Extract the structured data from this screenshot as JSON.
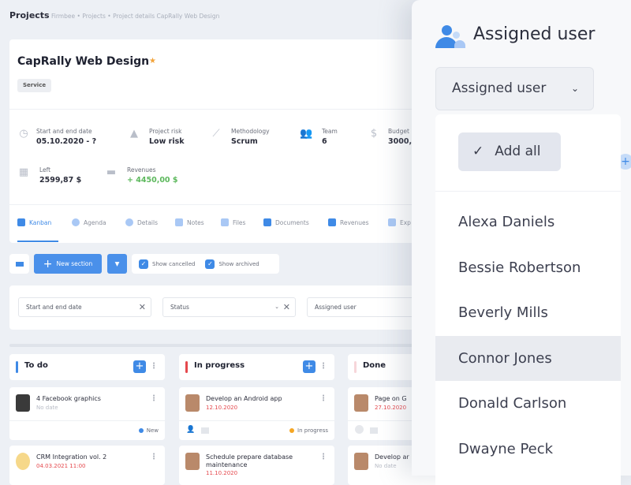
{
  "header": {
    "title": "Projects",
    "breadcrumb": [
      "Firmbee",
      "Projects",
      "Project details CapRally Web Design"
    ]
  },
  "project": {
    "title": "CapRally Web Design",
    "badge": "Service",
    "stats": [
      {
        "label": "Start and end date",
        "value": "05.10.2020 - ?",
        "icon": "clock-icon"
      },
      {
        "label": "Project risk",
        "value": "Low risk",
        "icon": "warning-icon"
      },
      {
        "label": "Methodology",
        "value": "Scrum",
        "icon": "chart-icon"
      },
      {
        "label": "Team",
        "value": "6",
        "icon": "team-icon"
      },
      {
        "label": "Budget",
        "value": "3000,",
        "icon": "dollar-icon"
      },
      {
        "label": "Left",
        "value": "2599,87 $",
        "icon": "calculator-icon"
      },
      {
        "label": "Revenues",
        "value": "+ 4450,00 $",
        "icon": "wallet-icon"
      }
    ],
    "tabs": [
      "Kanban",
      "Agenda",
      "Details",
      "Notes",
      "Files",
      "Documents",
      "Revenues",
      "Exp"
    ]
  },
  "toolbar": {
    "new_section": "New section",
    "show_cancelled": "Show cancelled",
    "show_archived": "Show archived"
  },
  "filters": {
    "date": "Start and end date",
    "status": "Status",
    "user": "Assigned user"
  },
  "columns": [
    {
      "title": "To do",
      "color": "#3f8ae6",
      "cards": [
        {
          "title": "4 Facebook graphics",
          "date": "No date",
          "status": "New",
          "status_color": "#3f8ae6"
        },
        {
          "title": "CRM Integration vol. 2",
          "date": "04.03.2021 11:00"
        }
      ]
    },
    {
      "title": "In progress",
      "color": "#e5484d",
      "cards": [
        {
          "title": "Develop an Android app",
          "date": "12.10.2020",
          "status": "In progress",
          "status_color": "#f5a623"
        },
        {
          "title": "Schedule prepare database",
          "title2": "maintenance",
          "date": "11.10.2020"
        }
      ]
    },
    {
      "title": "Done",
      "color": "#f7d6da",
      "cards": [
        {
          "title": "Page on G",
          "date": "27.10.2020"
        },
        {
          "title": "Develop ar",
          "date": "No date"
        }
      ]
    }
  ],
  "panel": {
    "title": "Assigned user",
    "select": "Assigned user",
    "add_all": "Add all",
    "users": [
      "Alexa Daniels",
      "Bessie Robertson",
      "Beverly Mills",
      "Connor Jones",
      "Donald Carlson",
      "Dwayne Peck"
    ],
    "highlighted": "Connor Jones"
  }
}
